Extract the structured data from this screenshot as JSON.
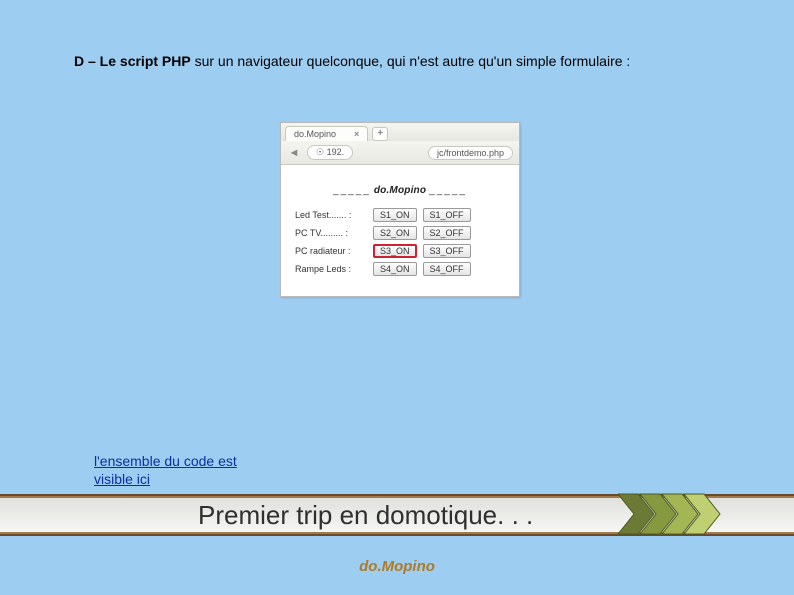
{
  "heading": {
    "bold": "D – Le script PHP",
    "rest": " sur un navigateur quelconque, qui n'est autre qu'un simple formulaire :"
  },
  "browser": {
    "tab_title": "do.Mopino",
    "tab_close": "×",
    "newtab_plus": "+",
    "back": "◄",
    "url_ip_prefix": "☉ 192.",
    "url_path": "jc/frontdemo.php",
    "title_deco": "_____",
    "title_brand": "do.Mopino",
    "rows": [
      {
        "label": "Led Test....... :",
        "on": "S1_ON",
        "off": "S1_OFF",
        "hl": false
      },
      {
        "label": "PC TV......... :",
        "on": "S2_ON",
        "off": "S2_OFF",
        "hl": false
      },
      {
        "label": "PC radiateur :",
        "on": "S3_ON",
        "off": "S3_OFF",
        "hl": true
      },
      {
        "label": "Rampe Leds :",
        "on": "S4_ON",
        "off": "S4_OFF",
        "hl": false
      }
    ]
  },
  "codelink": {
    "line1": "l'ensemble du code est",
    "line2": "visible ici"
  },
  "band_text": "Premier trip en domotique. . .",
  "footer_brand": "do.Mopino",
  "colors": {
    "chev": [
      "#6d7a35",
      "#86993f",
      "#a4b553",
      "#c0cf72"
    ]
  }
}
